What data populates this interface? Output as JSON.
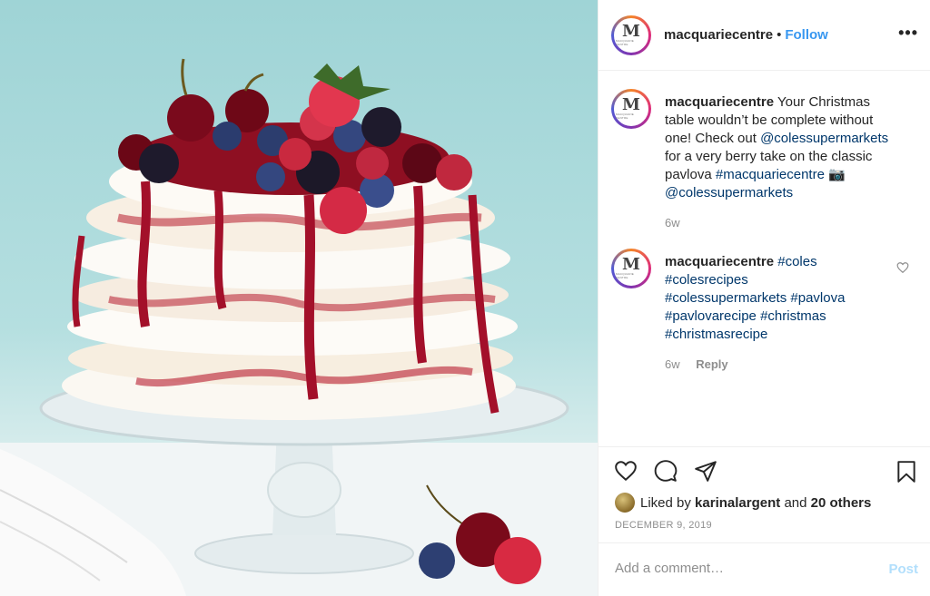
{
  "header": {
    "username": "macquariecentre",
    "separator": "•",
    "follow_label": "Follow",
    "more_label": "•••",
    "avatar_letter": "M",
    "avatar_subtext": "MACQUARIE CENTRE"
  },
  "caption": {
    "username": "macquariecentre",
    "text_1": "Your Christmas table wouldn’t be complete without one! Check out",
    "mention_1": "@colessupermarkets",
    "text_2": "for a very berry take on the classic pavlova",
    "hashtag_1": "#macquariecentre",
    "emoji": "📷",
    "mention_2": "@colessupermarkets",
    "time": "6w"
  },
  "comment": {
    "username": "macquariecentre",
    "tags": [
      "#coles",
      "#colesrecipes",
      "#colessupermarkets",
      "#pavlova",
      "#pavlovarecipe",
      "#christmas",
      "#christmasrecipe"
    ],
    "time": "6w",
    "reply_label": "Reply"
  },
  "likes": {
    "prefix": "Liked by",
    "user": "karinalargent",
    "joiner": "and",
    "others": "20 others"
  },
  "date": "DECEMBER 9, 2019",
  "add_comment": {
    "placeholder": "Add a comment…",
    "post_label": "Post"
  },
  "icons": {
    "like": "heart-icon",
    "comment": "comment-icon",
    "share": "share-icon",
    "save": "bookmark-icon",
    "more": "more-icon"
  },
  "colors": {
    "link": "#3897f0",
    "tag": "#00376b",
    "muted": "#8e8e8e",
    "post_disabled": "#b2dffc"
  }
}
